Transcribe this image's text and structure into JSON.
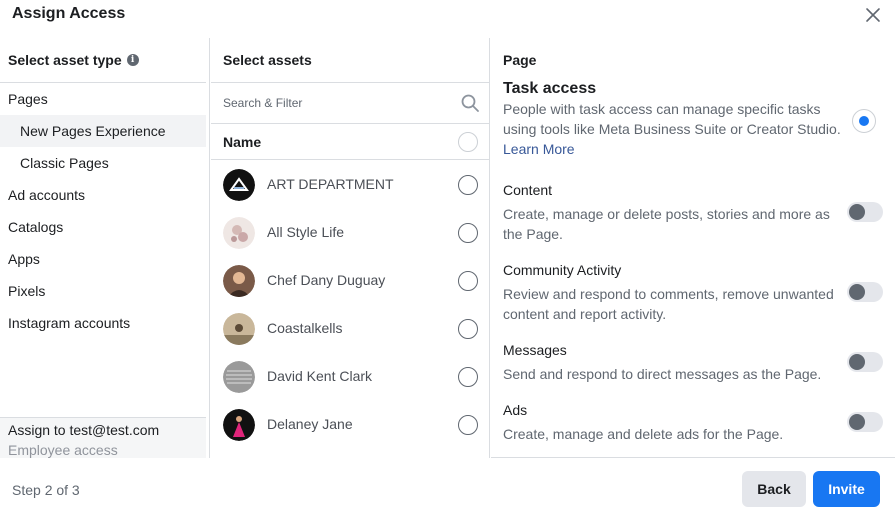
{
  "dialog": {
    "title": "Assign Access"
  },
  "left": {
    "heading": "Select asset type",
    "items": [
      {
        "label": "Pages",
        "sub": false,
        "selected": false
      },
      {
        "label": "New Pages Experience",
        "sub": true,
        "selected": true
      },
      {
        "label": "Classic Pages",
        "sub": true,
        "selected": false
      },
      {
        "label": "Ad accounts",
        "sub": false,
        "selected": false
      },
      {
        "label": "Catalogs",
        "sub": false,
        "selected": false
      },
      {
        "label": "Apps",
        "sub": false,
        "selected": false
      },
      {
        "label": "Pixels",
        "sub": false,
        "selected": false
      },
      {
        "label": "Instagram accounts",
        "sub": false,
        "selected": false
      }
    ],
    "assign_to": "Assign to test@test.com",
    "assign_sub": "Employee access"
  },
  "middle": {
    "heading": "Select assets",
    "search_placeholder": "Search & Filter",
    "name_header": "Name",
    "assets": [
      {
        "name": "ART DEPARTMENT"
      },
      {
        "name": "All Style Life"
      },
      {
        "name": "Chef Dany Duguay"
      },
      {
        "name": "Coastalkells"
      },
      {
        "name": "David Kent Clark"
      },
      {
        "name": "Delaney Jane"
      }
    ]
  },
  "right": {
    "heading": "Page",
    "task": {
      "title": "Task access",
      "desc": "People with task access can manage specific tasks using tools like Meta Business Suite or Creator Studio.",
      "link": "Learn More"
    },
    "permissions": [
      {
        "title": "Content",
        "desc": "Create, manage or delete posts, stories and more as the Page."
      },
      {
        "title": "Community Activity",
        "desc": "Review and respond to comments, remove unwanted content and report activity."
      },
      {
        "title": "Messages",
        "desc": "Send and respond to direct messages as the Page."
      },
      {
        "title": "Ads",
        "desc": "Create, manage and delete ads for the Page."
      }
    ]
  },
  "footer": {
    "step": "Step 2 of 3",
    "back_label": "Back",
    "invite_label": "Invite"
  },
  "colors": {
    "accent": "#1877f2",
    "link": "#385898"
  }
}
